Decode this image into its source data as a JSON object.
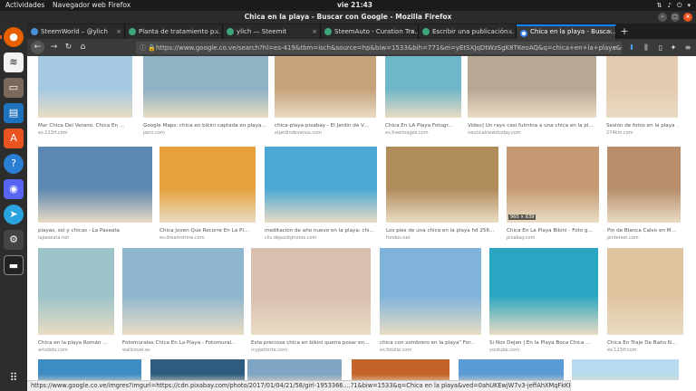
{
  "topbar": {
    "activities": "Actividades",
    "app": "Navegador web Firefox",
    "clock": "vie 21:43"
  },
  "window": {
    "title": "Chica en la playa - Buscar con Google - Mozilla Firefox"
  },
  "tabs": [
    {
      "label": "SteemWorld – @ylich"
    },
    {
      "label": "Planta de tratamiento p..."
    },
    {
      "label": "ylich — Steemit"
    },
    {
      "label": "SteemAuto - Curation Tra..."
    },
    {
      "label": "Escribir una publicación..."
    },
    {
      "label": "Chica en la playa - Busca..."
    }
  ],
  "address": {
    "url": "https://www.google.co.ve/search?hl=es-419&tbm=isch&source=hp&biw=1533&bih=771&ei=yEtSXJqDtWzSgK8TKeoAQ&q=chica+en+la+playa&oq=chica+en+la+playa..."
  },
  "results": [
    {
      "caption": "Mar Chica Del Verano. Chica En ...",
      "source": "es.123rf.com",
      "color": "#a6c9e2"
    },
    {
      "caption": "Google Maps: chica en bikini captada en playa...",
      "source": "peru.com",
      "color": "#8fb2c4"
    },
    {
      "caption": "chica-playa-pixabay - El Jardín de V...",
      "source": "eljardindevenus.com",
      "color": "#c7a37c"
    },
    {
      "caption": "Chica En LA Playa Fotogr...",
      "source": "es.freeimages.com",
      "color": "#6fb6c8"
    },
    {
      "caption": "Video] Un rayo casi fulmina a una chica en la pl...",
      "source": "nauticalnewstoday.com",
      "color": "#b7a895"
    },
    {
      "caption": "Sesión de fotos en la playa ...",
      "source": "274km.com",
      "color": "#e3cbb1"
    },
    {
      "caption": "playas, sol y chicas - La Paseata",
      "source": "lapaseata.net",
      "color": "#5b87b0"
    },
    {
      "caption": "Chica Joven Que Recorre En La Pl...",
      "source": "es.dreamstime.com",
      "color": "#e6a13c"
    },
    {
      "caption": "meditación de año nuevo en la playa: chi...",
      "source": "cliv.depositphotos.com",
      "color": "#4aa7d6"
    },
    {
      "caption": "Los pies de una chica en la playa hd 256...",
      "source": "fondos.net",
      "color": "#b08c5a"
    },
    {
      "caption": "Chica En La Playa Bikini - Foto g...",
      "source": "pixabay.com",
      "color": "#c59a72",
      "dims": "960 × 639"
    },
    {
      "caption": "Pin de Blanca Calvo en M...",
      "source": "pinterest.com",
      "color": "#b78d6c"
    },
    {
      "caption": "Chica en la playa Román ...",
      "source": "artsdots.com",
      "color": "#9cc4c9"
    },
    {
      "caption": "Fotomurales Chica En La Playa - Fotomural...",
      "source": "wallcover.es",
      "color": "#8fb6cf"
    },
    {
      "caption": "Esta preciosa chica en bikini quería posar en...",
      "source": "mypeitorte.com",
      "color": "#d9bfb0"
    },
    {
      "caption": "chica con sombrero en la playa\" For...",
      "source": "es.fotolia.com",
      "color": "#7fb3da"
    },
    {
      "caption": "Si Nos Dejan | En la Playa Boca Chica ...",
      "source": "youtube.com",
      "color": "#2aa6c2"
    },
    {
      "caption": "Chica En Traje De Baño N...",
      "source": "es.123rf.com",
      "color": "#e0c4a0"
    },
    {
      "caption": "",
      "source": "",
      "color": "#3e8cc4"
    },
    {
      "caption": "",
      "source": "",
      "color": "#2d5c7e"
    },
    {
      "caption": "",
      "source": "",
      "color": "#7ea6c4"
    },
    {
      "caption": "",
      "source": "",
      "color": "#c4632a"
    },
    {
      "caption": "",
      "source": "",
      "color": "#5a9bd6"
    },
    {
      "caption": "",
      "source": "",
      "color": "#b8dcef"
    }
  ],
  "status": "https://www.google.co.ve/imgres?imgurl=https://cdn.pixabay.com/photo/2017/01/04/21/58/girl-1953366....?1&biw=1533&q=Chica en la playa&ved=0ahUKEwjW7v3-jeffAhXMqFkKHcGpBssQMwi3AihKMEo&iact=mrc&uact=8"
}
